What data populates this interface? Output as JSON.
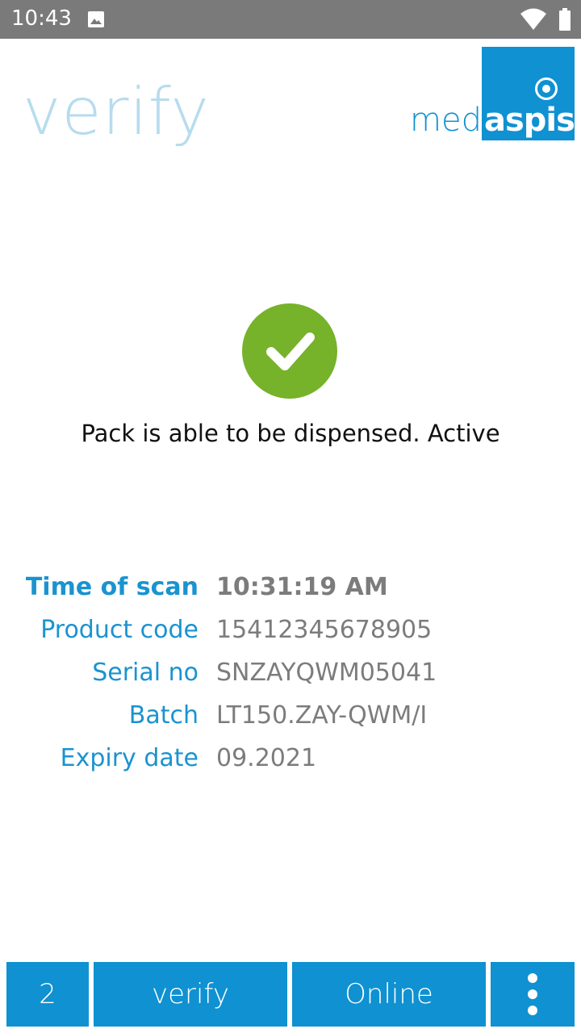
{
  "status_bar": {
    "time": "10:43",
    "icons": [
      "image-icon",
      "wifi-icon",
      "battery-icon"
    ]
  },
  "header": {
    "title": "verify",
    "logo": {
      "part1": "med",
      "part2": "aspis"
    }
  },
  "result": {
    "icon": "check-icon",
    "message": "Pack is able to be dispensed. Active",
    "color": "#76b22a"
  },
  "details": [
    {
      "label": "Time of scan",
      "value": "10:31:19 AM"
    },
    {
      "label": "Product code",
      "value": "15412345678905"
    },
    {
      "label": "Serial no",
      "value": "SNZAYQWM05041"
    },
    {
      "label": "Batch",
      "value": "LT150.ZAY-QWM/I"
    },
    {
      "label": "Expiry date",
      "value": "09.2021"
    }
  ],
  "bottom_bar": {
    "count": "2",
    "mode": "verify",
    "connection": "Online",
    "menu_icon": "more-vert-icon"
  },
  "colors": {
    "accent": "#0f91d2",
    "label": "#1a93d0",
    "value": "#7c7c7c",
    "title": "#b6dcee"
  }
}
